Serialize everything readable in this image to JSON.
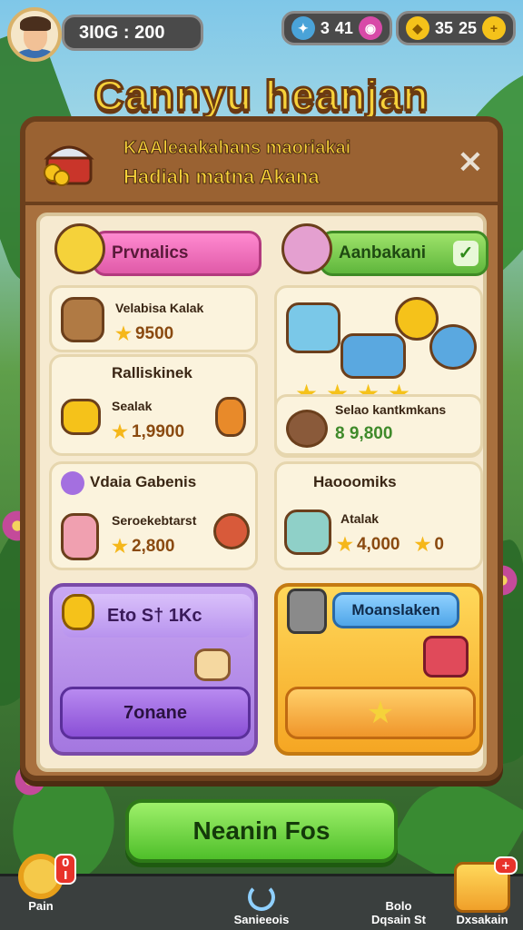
{
  "hud": {
    "score": "3I0G : 200",
    "resources": [
      {
        "icon": "gem-icon",
        "value": "3",
        "color": "#4aa3d8"
      },
      {
        "icon": "pink-orb-icon",
        "value": "41",
        "color": "#d84aa8"
      },
      {
        "icon": "gold-drop-icon",
        "value": "35",
        "color": "#f5c21a"
      },
      {
        "icon": "coin-icon",
        "value": "25",
        "color": "#f5c21a"
      }
    ]
  },
  "title": "Cannyu heanjan",
  "panel": {
    "line1": "KAAleaakahans maoriakai",
    "line2": "Hadiah matna Akana",
    "close": "×"
  },
  "tabs": [
    {
      "label": "Prvnalics",
      "color": "#e05aa8"
    },
    {
      "label": "Aanbakani",
      "color": "#5fb63c",
      "check": "✓"
    }
  ],
  "cards": {
    "c1": {
      "title": "Velabisa Kalak",
      "price": "9500"
    },
    "c2": {
      "title": "Ralliskinek",
      "sub": "Sealak",
      "price": "1,9900"
    },
    "c3": {
      "title": "Selao kantkmkans",
      "price": "8 9,800"
    },
    "c4": {
      "title": "Vdaia Gabenis",
      "sub": "Seroekebtarst",
      "price": "2,800"
    },
    "c5": {
      "title": "Haooomiks",
      "sub": "Atalak",
      "price": "4,000",
      "price2": "0"
    }
  },
  "promo_purple": {
    "head": "Eto S† 1Kc",
    "button": "7onane"
  },
  "promo_orange": {
    "tag": "Moanslaken"
  },
  "cta": "Neanin Fos",
  "nav": {
    "left": {
      "label": "Pain",
      "badge": "0 I"
    },
    "center": {
      "label": "Sanieeois"
    },
    "right_text": {
      "line1": "Bolo",
      "line2": "Dqsain St"
    },
    "right": {
      "label": "Dxsakain",
      "badge": "+"
    }
  }
}
